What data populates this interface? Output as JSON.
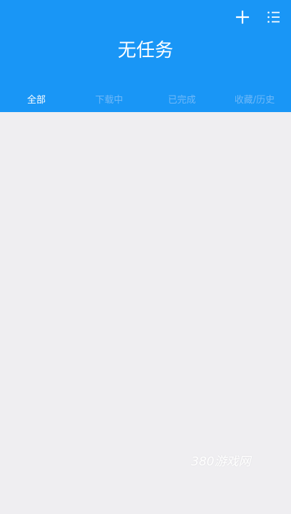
{
  "header": {
    "title": "无任务",
    "add_icon": "plus-icon",
    "menu_icon": "list-icon"
  },
  "tabs": [
    {
      "label": "全部"
    },
    {
      "label": "下载中"
    },
    {
      "label": "已完成"
    },
    {
      "label": "收藏/历史"
    }
  ],
  "watermark": {
    "text": "380游戏网"
  },
  "colors": {
    "header_bg": "#1996f6",
    "content_bg": "#efeef1",
    "active_tab": "#ffffff",
    "inactive_tab": "#71b9f8"
  }
}
